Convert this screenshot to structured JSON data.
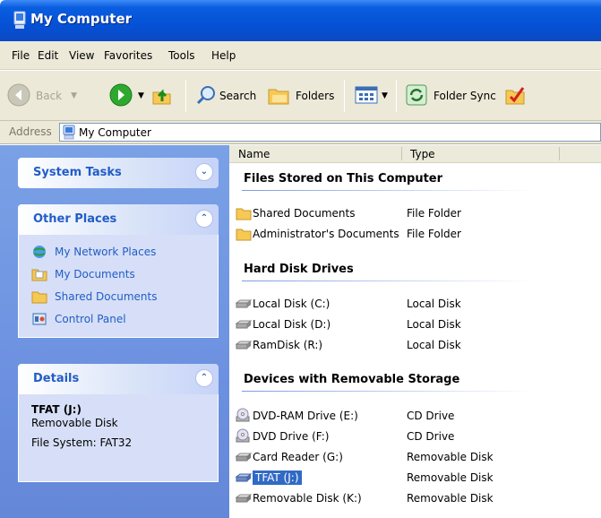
{
  "window": {
    "title": "My Computer"
  },
  "menu": [
    "File",
    "Edit",
    "View",
    "Favorites",
    "Tools",
    "Help"
  ],
  "toolbar": {
    "back": "Back",
    "search": "Search",
    "folders": "Folders",
    "folder_sync": "Folder Sync"
  },
  "address": {
    "label": "Address",
    "value": "My Computer"
  },
  "sidebar": {
    "system_tasks": {
      "title": "System Tasks"
    },
    "other_places": {
      "title": "Other Places",
      "items": [
        {
          "label": "My Network Places",
          "icon": "network-places-icon"
        },
        {
          "label": "My Documents",
          "icon": "my-documents-icon"
        },
        {
          "label": "Shared Documents",
          "icon": "folder-icon"
        },
        {
          "label": "Control Panel",
          "icon": "control-panel-icon"
        }
      ]
    },
    "details": {
      "title": "Details",
      "name": "TFAT (J:)",
      "type": "Removable Disk",
      "fs": "File System: FAT32"
    }
  },
  "columns": {
    "name": "Name",
    "type": "Type"
  },
  "groups": [
    {
      "title": "Files Stored on This Computer",
      "items": [
        {
          "name": "Shared Documents",
          "type": "File Folder",
          "icon": "folder-icon"
        },
        {
          "name": "Administrator's Documents",
          "type": "File Folder",
          "icon": "folder-icon"
        }
      ]
    },
    {
      "title": "Hard Disk Drives",
      "items": [
        {
          "name": "Local Disk (C:)",
          "type": "Local Disk",
          "icon": "hard-disk-icon"
        },
        {
          "name": "Local Disk (D:)",
          "type": "Local Disk",
          "icon": "hard-disk-icon"
        },
        {
          "name": "RamDisk (R:)",
          "type": "Local Disk",
          "icon": "hard-disk-icon"
        }
      ]
    },
    {
      "title": "Devices with Removable Storage",
      "items": [
        {
          "name": "DVD-RAM Drive (E:)",
          "type": "CD Drive",
          "icon": "dvd-drive-icon"
        },
        {
          "name": "DVD Drive (F:)",
          "type": "CD Drive",
          "icon": "dvd-drive-icon"
        },
        {
          "name": "Card Reader (G:)",
          "type": "Removable Disk",
          "icon": "removable-disk-icon"
        },
        {
          "name": "TFAT (J:)",
          "type": "Removable Disk",
          "icon": "removable-disk-icon",
          "selected": true
        },
        {
          "name": "Removable Disk (K:)",
          "type": "Removable Disk",
          "icon": "removable-disk-icon"
        }
      ]
    }
  ],
  "colors": {
    "title_bar": "#0551d6",
    "sidebar_bg": "#6f94e2",
    "link": "#215dc6",
    "selection": "#316ac5"
  }
}
